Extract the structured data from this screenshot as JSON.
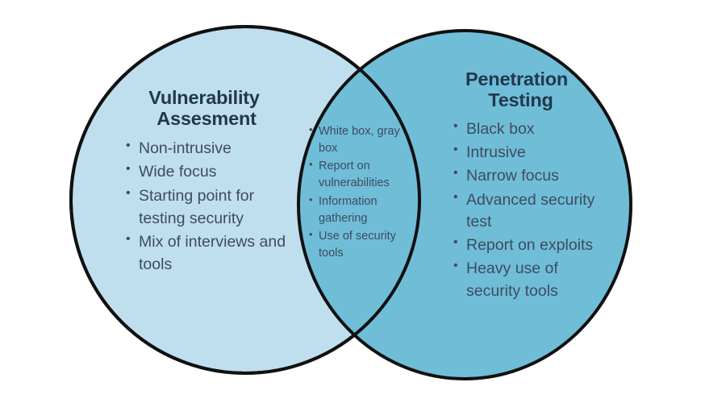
{
  "diagram": {
    "type": "venn",
    "background_color": "#ffffff",
    "outline_color": "#111111",
    "title_color": "#22384c",
    "body_text_color": "#3d4c5e",
    "bullet_glyph": "•"
  },
  "left_circle": {
    "name": "vulnerability-assesment-circle",
    "fill_color": "#c0dfee",
    "title_line1": "Vulnerability",
    "title_line2": "Assesment",
    "items": [
      "Non-intrusive",
      "Wide focus",
      "Starting point for testing security",
      "Mix of interviews and tools"
    ]
  },
  "right_circle": {
    "name": "penetration-testing-circle",
    "fill_color": "#70bdd8",
    "title_line1": "Penetration",
    "title_line2": "Testing",
    "items": [
      "Black box",
      "Intrusive",
      "Narrow focus",
      "Advanced security test",
      "Report on exploits",
      "Heavy use of security tools"
    ]
  },
  "intersection": {
    "name": "shared-attributes-region",
    "fill_color": "#70bdd8",
    "items": [
      "White box, gray box",
      "Report on vulnerabilities",
      "Information gathering",
      "Use of security tools"
    ]
  }
}
